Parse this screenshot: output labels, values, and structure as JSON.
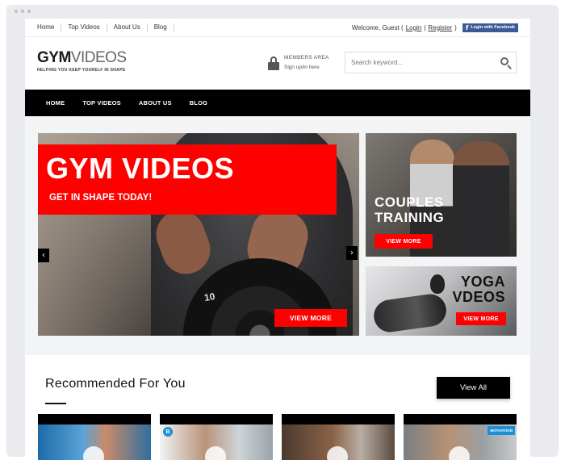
{
  "topbar": {
    "links": [
      "Home",
      "Top Videos",
      "About Us",
      "Blog"
    ],
    "welcome": "Welcome, Guest (",
    "login": "Login",
    "separator": "|",
    "register": "Register",
    "close_paren": ")",
    "fb_label": "Login with Facebook"
  },
  "header": {
    "logo_bold": "GYM",
    "logo_light": "VIDEOS",
    "tagline": "HELPING YOU KEEP YOURELF IN SHAPE",
    "members_title": "MEMBERS AREA",
    "members_link": "Sign up/in here",
    "search_placeholder": "Search keyword..."
  },
  "nav": {
    "items": [
      "HOME",
      "TOP VIDEOS",
      "ABOUT US",
      "BLOG"
    ]
  },
  "hero": {
    "title": "GYM VIDEOS",
    "subtitle": "GET IN SHAPE TODAY!",
    "button": "VIEW MORE",
    "plate_number": "10",
    "prev_arrow": "‹",
    "next_arrow": "›"
  },
  "side_slides": [
    {
      "title_line1": "COUPLES",
      "title_line2": "TRAINING",
      "button": "VIEW MORE"
    },
    {
      "title_line1": "YOGA",
      "title_line2": "VDEOS",
      "button": "VIEW MORE"
    }
  ],
  "recommended": {
    "title": "Recommended For You",
    "view_all": "View All",
    "thumb2_badge": "B",
    "thumb4_badge": "MOTIVATION"
  },
  "colors": {
    "accent": "#ff0000",
    "nav_bg": "#000000",
    "facebook": "#3b5998"
  }
}
